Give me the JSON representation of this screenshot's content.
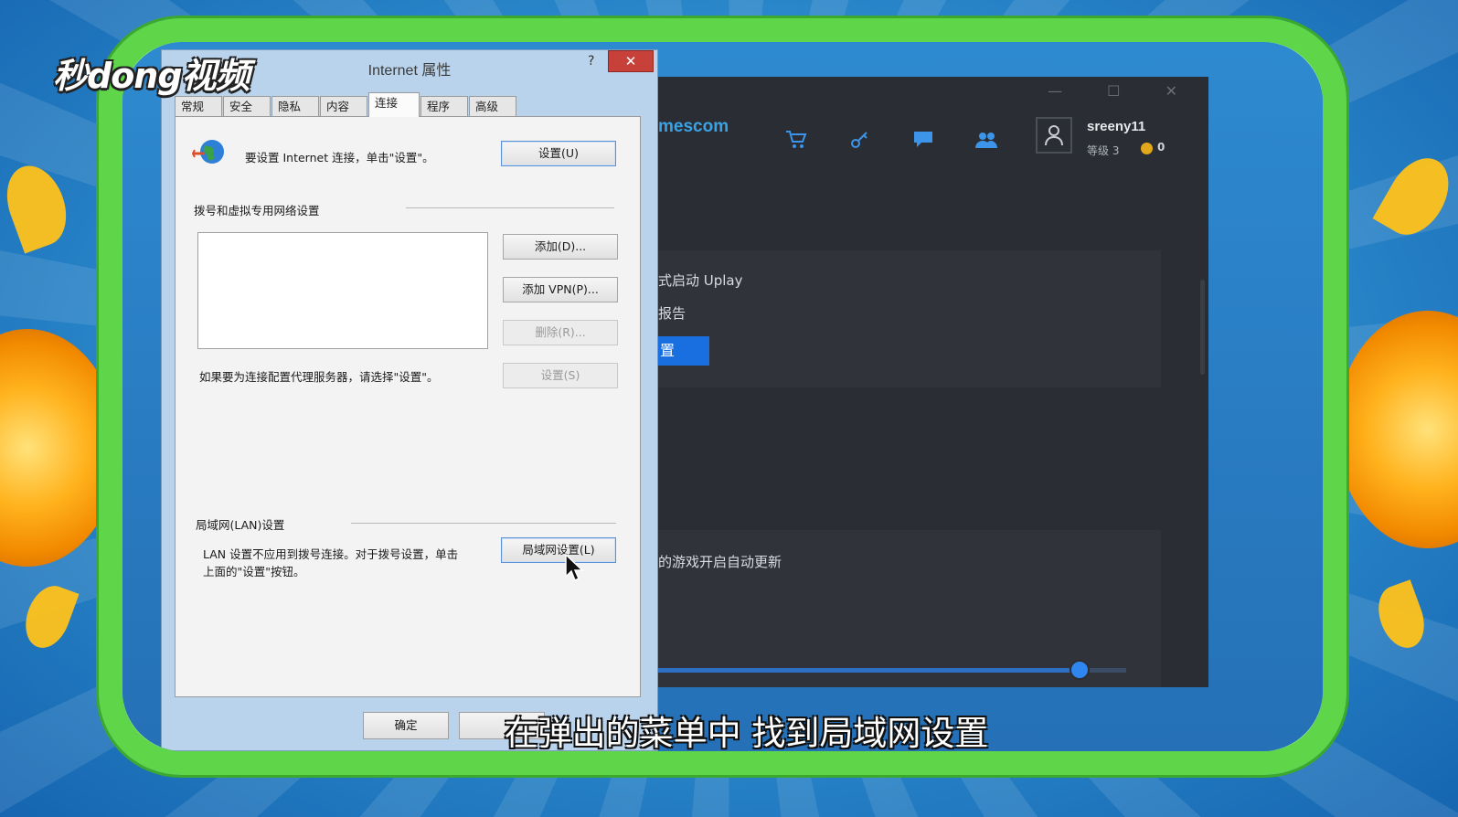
{
  "watermark": {
    "logo_text": "秒dong视频"
  },
  "subtitle": "在弹出的菜单中 找到局域网设置",
  "uplay": {
    "brand": "mescom",
    "nav_icons": [
      "cart-icon",
      "key-icon",
      "chat-icon",
      "friends-icon"
    ],
    "profile": {
      "username": "sreeny11",
      "level": "等级 3",
      "coins": "0"
    },
    "settings": {
      "launch_text": "式启动 Uplay",
      "report_text": "报告",
      "button_label": "置",
      "auto_update_text": "的游戏开启自动更新"
    },
    "slider_level": 0.9
  },
  "dialog": {
    "title": "Internet 属性",
    "help_label": "?",
    "close_label": "✕",
    "tabs": [
      "常规",
      "安全",
      "隐私",
      "内容",
      "连接",
      "程序",
      "高级"
    ],
    "active_tab": "连接",
    "setup_text": "要设置 Internet 连接，单击\"设置\"。",
    "setup_button": "设置(U)",
    "dialup_heading": "拨号和虚拟专用网络设置",
    "add_button": "添加(D)...",
    "add_vpn_button": "添加 VPN(P)...",
    "remove_button": "删除(R)...",
    "settings_button": "设置(S)",
    "proxy_text": "如果要为连接配置代理服务器，请选择\"设置\"。",
    "lan_heading": "局域网(LAN)设置",
    "lan_text_line1": "LAN 设置不应用到拨号连接。对于拨号设置，单击",
    "lan_text_line2": "上面的\"设置\"按钮。",
    "lan_button": "局域网设置(L)",
    "ok_button": "确定"
  }
}
